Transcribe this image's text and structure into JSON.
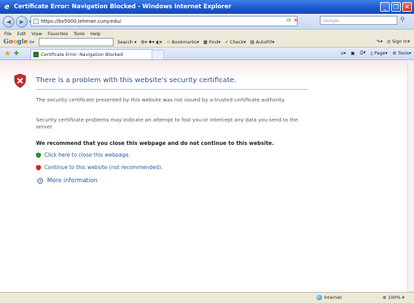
{
  "window": {
    "title": "Certificate Error: Navigation Blocked - Windows Internet Explorer"
  },
  "address": {
    "url": "https://bx5000.lehman.cuny.edu/",
    "search_placeholder": "Google"
  },
  "menu": [
    "File",
    "Edit",
    "View",
    "Favorites",
    "Tools",
    "Help"
  ],
  "google_toolbar": {
    "search_label": "Search",
    "bookmarks_label": "Bookmarks",
    "find_label": "Find",
    "check_label": "Check",
    "autofill_label": "AutoFill",
    "signin_label": "Sign In"
  },
  "tab": {
    "label": "Certificate Error: Navigation Blocked"
  },
  "command_bar": {
    "page_label": "Page",
    "tools_label": "Tools"
  },
  "content": {
    "headline": "There is a problem with this website's security certificate.",
    "para1": "The security certificate presented by this website was not issued by a trusted certificate authority.",
    "para2": "Security certificate problems may indicate an attempt to fool you or intercept any data you send to the server.",
    "recommendation": "We recommend that you close this webpage and do not continue to this website.",
    "close_link": "Click here to close this webpage.",
    "continue_link": "Continue to this website (not recommended).",
    "more_info": "More information"
  },
  "status": {
    "zone": "Internet",
    "zoom": "100%"
  },
  "colors": {
    "title_blue": "#1b56d0",
    "link_blue": "#2d55a0",
    "shield_red": "#c8282a",
    "safe_green": "#2e8b2e"
  }
}
